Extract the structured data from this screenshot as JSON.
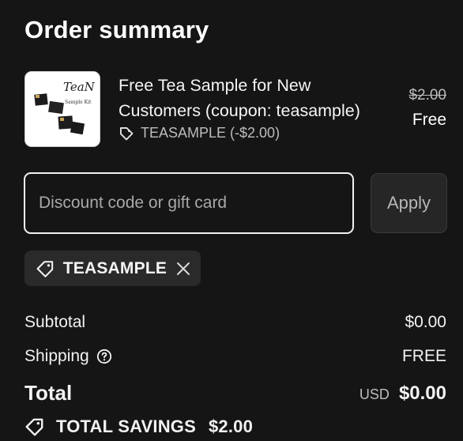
{
  "title": "Order summary",
  "product": {
    "name": "Free Tea Sample for New Customers (coupon: teasample)",
    "discount_line": "TEASAMPLE (-$2.00)",
    "original_price": "$2.00",
    "price": "Free",
    "thumbnail_text": "TeaN",
    "thumbnail_subtext": "Sample Kit"
  },
  "discount": {
    "placeholder": "Discount code or gift card",
    "value": "",
    "apply_label": "Apply"
  },
  "applied_code": {
    "code": "TEASAMPLE"
  },
  "totals": {
    "subtotal_label": "Subtotal",
    "subtotal_value": "$0.00",
    "shipping_label": "Shipping",
    "shipping_value": "FREE",
    "total_label": "Total",
    "currency": "USD",
    "total_value": "$0.00",
    "savings_label": "TOTAL SAVINGS",
    "savings_value": "$2.00"
  },
  "icons": {
    "tag": "tag-icon",
    "help": "help-circle-icon",
    "close": "close-icon"
  },
  "colors": {
    "background": "#151515",
    "text": "#f2f2f2",
    "muted": "#bdbdbd",
    "chip_bg": "#2a2a2a",
    "button_bg": "#262626"
  }
}
